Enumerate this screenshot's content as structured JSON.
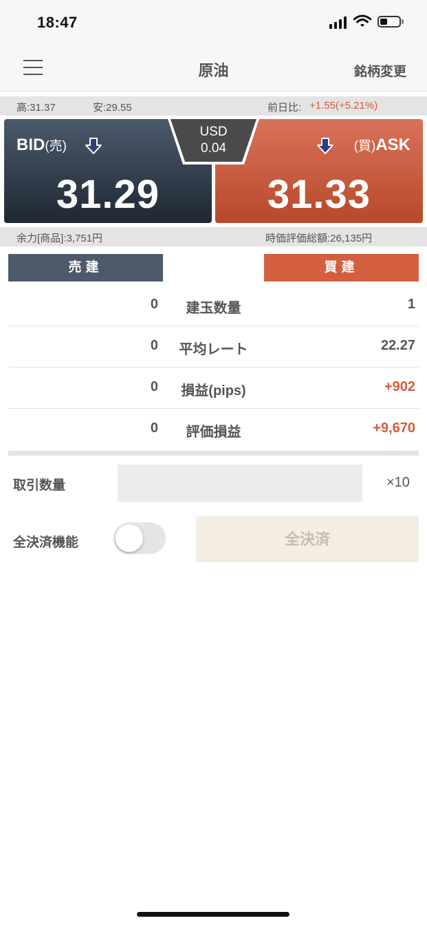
{
  "status_bar": {
    "time": "18:47"
  },
  "nav": {
    "title": "原油",
    "right_label": "銘柄変更"
  },
  "info_top": {
    "high": "高:31.37",
    "low": "安:29.55",
    "change_label": "前日比:",
    "change_value": "+1.55(+5.21%)"
  },
  "bid": {
    "label": "BID",
    "sub": "(売)",
    "price": "31.29"
  },
  "ask": {
    "label": "ASK",
    "sub": "(買)",
    "price": "31.33"
  },
  "spread": {
    "currency": "USD",
    "value": "0.04"
  },
  "info_bottom": {
    "margin": "余力[商品]:3,751円",
    "valuation": "時価評価総額:26,135円"
  },
  "actions": {
    "sell": "売建",
    "buy": "買建"
  },
  "positions": [
    {
      "sell": "0",
      "label": "建玉数量",
      "buy": "1",
      "buy_color": "normal"
    },
    {
      "sell": "0",
      "label": "平均レート",
      "buy": "22.27",
      "buy_color": "normal"
    },
    {
      "sell": "0",
      "label": "損益(pips)",
      "buy": "+902",
      "buy_color": "red"
    },
    {
      "sell": "0",
      "label": "評価損益",
      "buy": "+9,670",
      "buy_color": "red"
    }
  ],
  "order": {
    "qty_label": "取引数量",
    "qty_value": "",
    "multiplier": "×10",
    "close_all_label": "全決済機能",
    "close_all_button": "全決済"
  },
  "colors": {
    "bid": "#2f3a47",
    "ask": "#c9573a",
    "accent_red": "#d65b38"
  }
}
